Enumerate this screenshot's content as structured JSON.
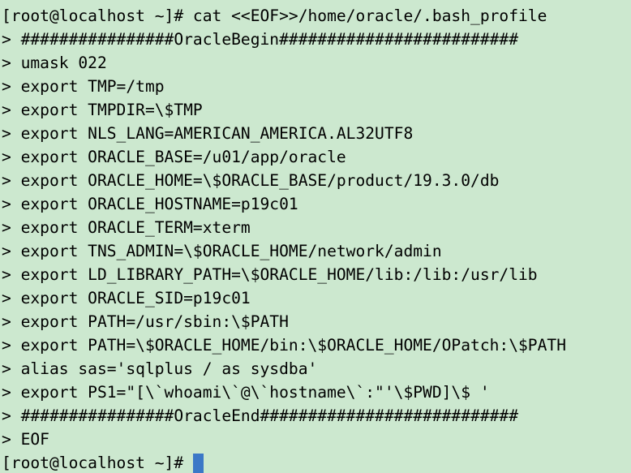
{
  "terminal": {
    "lines": [
      "[root@localhost ~]# cat <<EOF>>/home/oracle/.bash_profile",
      "> ################OracleBegin#########################",
      "> umask 022",
      "> export TMP=/tmp",
      "> export TMPDIR=\\$TMP",
      "> export NLS_LANG=AMERICAN_AMERICA.AL32UTF8",
      "> export ORACLE_BASE=/u01/app/oracle",
      "> export ORACLE_HOME=\\$ORACLE_BASE/product/19.3.0/db",
      "> export ORACLE_HOSTNAME=p19c01",
      "> export ORACLE_TERM=xterm",
      "> export TNS_ADMIN=\\$ORACLE_HOME/network/admin",
      "> export LD_LIBRARY_PATH=\\$ORACLE_HOME/lib:/lib:/usr/lib",
      "> export ORACLE_SID=p19c01",
      "> export PATH=/usr/sbin:\\$PATH",
      "> export PATH=\\$ORACLE_HOME/bin:\\$ORACLE_HOME/OPatch:\\$PATH",
      "> alias sas='sqlplus / as sysdba'",
      "> export PS1=\"[\\`whoami\\`@\\`hostname\\`:\"'\\$PWD]\\$ '",
      "> ################OracleEnd###########################",
      "> EOF"
    ],
    "prompt": "[root@localhost ~]#",
    "background_color": "#cce8cf",
    "text_color": "#000000",
    "cursor_color": "#3b78c7"
  }
}
